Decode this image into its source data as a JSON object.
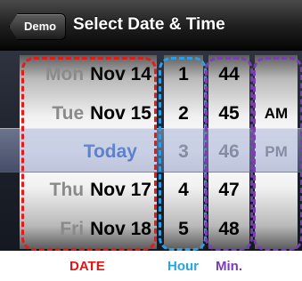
{
  "navbar": {
    "back_label": "Demo",
    "title": "Select Date & Time"
  },
  "picker": {
    "date_wheel": [
      {
        "weekday": "Mon",
        "date": "Nov 14"
      },
      {
        "weekday": "Tue",
        "date": "Nov 15"
      },
      {
        "weekday": "",
        "date": "Today",
        "selected": true
      },
      {
        "weekday": "Thu",
        "date": "Nov 17"
      },
      {
        "weekday": "Fri",
        "date": "Nov 18"
      }
    ],
    "hour_wheel": [
      "1",
      "2",
      "3",
      "4",
      "5"
    ],
    "minute_wheel": [
      "44",
      "45",
      "46",
      "47",
      "48"
    ],
    "ampm_wheel": [
      "",
      "AM",
      "PM",
      "",
      ""
    ],
    "selected_row_index": 2
  },
  "annotations": {
    "date_label": "DATE",
    "hour_label": "Hour",
    "minute_label": "Min.",
    "colors": {
      "date": "#e31b1b",
      "hour": "#2a9fe8",
      "minute": "#7a3fb0",
      "today_text": "#2e66cc"
    }
  }
}
